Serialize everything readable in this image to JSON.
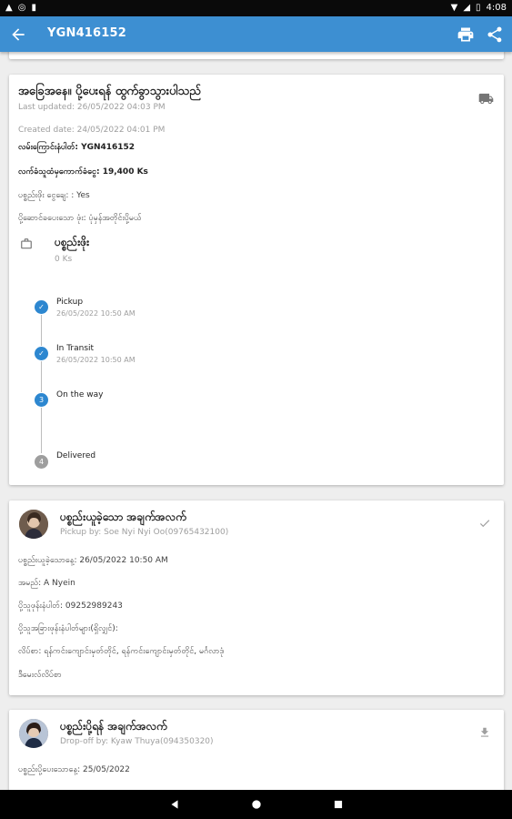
{
  "status_bar": {
    "time": "4:08"
  },
  "app_bar": {
    "title": "YGN416152"
  },
  "shipment": {
    "status_title": "အခြေအနေ။ ပို့ပေးရန် ထွက်ခွာသွားပါသည်",
    "last_updated": "Last updated: 26/05/2022 04:03 PM",
    "created_date": "Created date: 24/05/2022 04:01 PM",
    "tracking_label": "လမ်းကြောင်းနံပါတ်: YGN416152",
    "amount_label": "လက်ခံသူထံမှကောက်ခံငွေ: 19,400 Ks",
    "prepaid_label": "ပစ္စည်းဖိုး ငွေချေ: : Yes",
    "payer_label": "ပို့ဆောင်ခပေးသော ဖုံး: ပုံမှန်အတိုင်းပို့မယ်",
    "fee_title": "ပစ္စည်းဖိုး",
    "fee_value": "0 Ks"
  },
  "timeline": [
    {
      "number": "1",
      "label": "Pickup",
      "date": "26/05/2022 10:50 AM",
      "state": "done"
    },
    {
      "number": "2",
      "label": "In Transit",
      "date": "26/05/2022 10:50 AM",
      "state": "done"
    },
    {
      "number": "3",
      "label": "On the way",
      "date": "",
      "state": "active"
    },
    {
      "number": "4",
      "label": "Delivered",
      "date": "",
      "state": "pending"
    }
  ],
  "pickup_card": {
    "title": "ပစ္စည်းယူခဲ့သော အချက်အလက်",
    "subtitle": "Pickup by: Soe Nyi Nyi Oo(09765432100)",
    "pickup_date": "ပစ္စည်းယူခဲ့သောနေ့: 26/05/2022 10:50 AM",
    "name": "အမည်: A Nyein",
    "phone": "ပို့သူဖုန်းနံပါတ်: 09252989243",
    "other_phones_label": "ပို့သူအခြားဖုန်းနံပါတ်များ(ရှိလျှင်):",
    "address": "လိပ်စာ: ရန်ကင်းကျောင်းမှတ်တိုင်, ရန်ကင်းကျောင်းမှတ်တိုင်, မင်္ဂလာဒုံ",
    "extra": "ဒီမေးလ်လိပ်စာ"
  },
  "dropoff_card": {
    "title": "ပစ္စည်းပို့ရန် အချက်အလက်",
    "subtitle": "Drop-off by: Kyaw Thuya(094350320)",
    "dropoff_date": "ပစ္စည်းပို့ပေးသောနေ့: 25/05/2022"
  },
  "colors": {
    "app_bar": "#3d8fd2",
    "step_done": "#2d87d0",
    "step_pending": "#9e9e9e"
  }
}
